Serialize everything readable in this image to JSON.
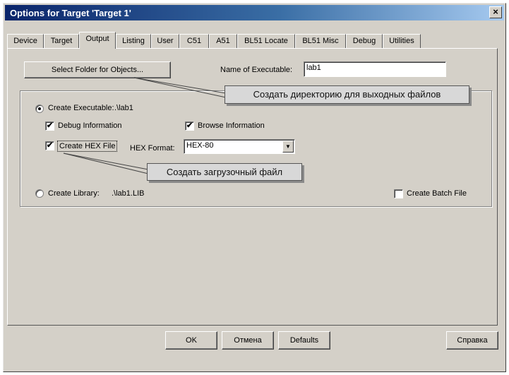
{
  "window": {
    "title": "Options for Target 'Target 1'"
  },
  "tabs": [
    {
      "label": "Device"
    },
    {
      "label": "Target"
    },
    {
      "label": "Output"
    },
    {
      "label": "Listing"
    },
    {
      "label": "User"
    },
    {
      "label": "C51"
    },
    {
      "label": "A51"
    },
    {
      "label": "BL51 Locate"
    },
    {
      "label": "BL51 Misc"
    },
    {
      "label": "Debug"
    },
    {
      "label": "Utilities"
    }
  ],
  "output": {
    "select_folder_button": "Select Folder for Objects...",
    "name_of_executable_label": "Name of Executable:",
    "name_of_executable_value": "lab1",
    "create_executable_label": "Create Executable:",
    "create_executable_path": ".\\lab1",
    "debug_information_label": "Debug Information",
    "browse_information_label": "Browse Information",
    "create_hex_label": "Create HEX File",
    "hex_format_label": "HEX Format:",
    "hex_format_value": "HEX-80",
    "create_library_label": "Create Library:",
    "create_library_path": ".\\lab1.LIB",
    "create_batch_label": "Create Batch File"
  },
  "checks": {
    "debug": "✔",
    "browse": "✔",
    "hex": "✔"
  },
  "annotations": {
    "folder_note": "Создать директорию для выходных файлов",
    "hex_note": "Создать загрузочный файл"
  },
  "buttons": {
    "ok": "OK",
    "cancel": "Отмена",
    "defaults": "Defaults",
    "help": "Справка"
  },
  "icons": {
    "close": "×",
    "dropdown": "▼"
  },
  "colors": {
    "title_start": "#0a246a",
    "title_end": "#a6caf0",
    "face": "#d4d0c8"
  }
}
